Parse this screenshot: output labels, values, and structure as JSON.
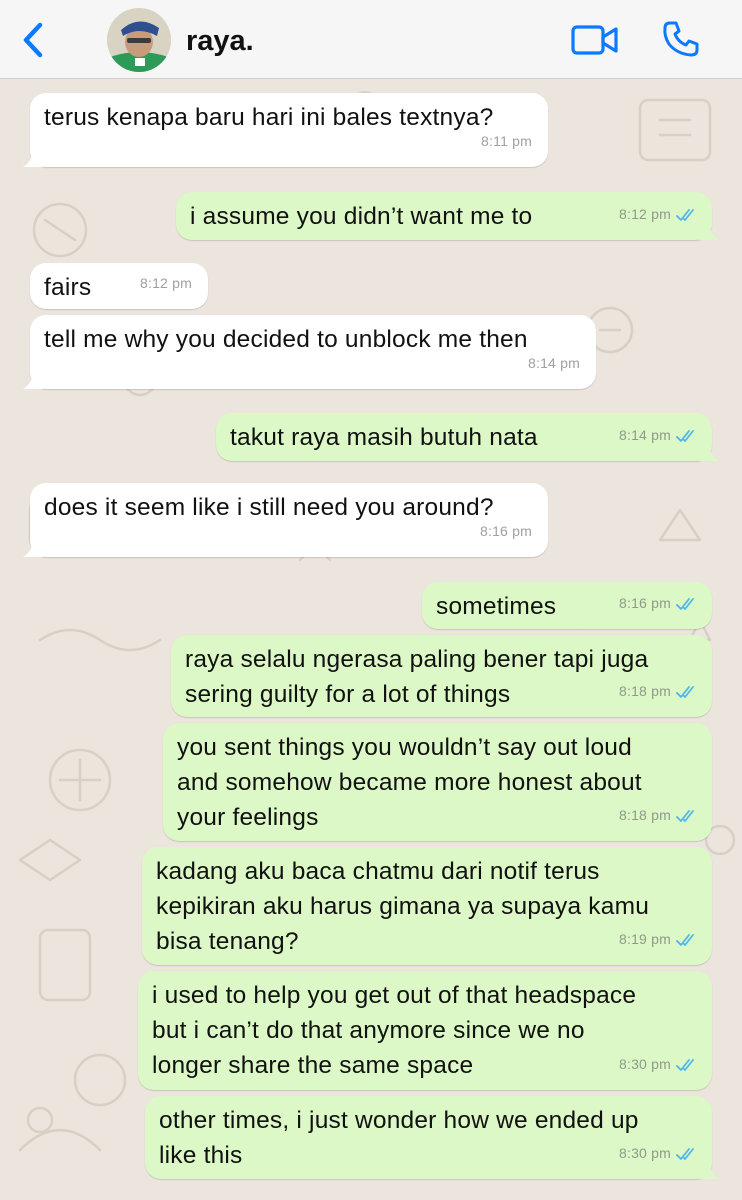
{
  "header": {
    "contact_name": "raya.",
    "back_icon": "chevron-left-icon",
    "video_icon": "video-camera-icon",
    "call_icon": "phone-icon",
    "accent_color": "#0a7aff"
  },
  "messages": [
    {
      "direction": "in",
      "text": "terus kenapa baru hari ini bales textnya?",
      "time": "8:11 pm"
    },
    {
      "direction": "out",
      "text": "i assume you didn’t want me to",
      "time": "8:12 pm",
      "status": "read"
    },
    {
      "direction": "in",
      "text": "fairs",
      "time": "8:12 pm"
    },
    {
      "direction": "in",
      "text": "tell me why you decided to unblock me then",
      "time": "8:14 pm"
    },
    {
      "direction": "out",
      "text": "takut raya masih butuh nata",
      "time": "8:14 pm",
      "status": "read"
    },
    {
      "direction": "in",
      "text": "does it seem like i still need you around?",
      "time": "8:16 pm"
    },
    {
      "direction": "out",
      "text": "sometimes",
      "time": "8:16 pm",
      "status": "read"
    },
    {
      "direction": "out",
      "text": "raya selalu ngerasa paling bener tapi juga\nsering guilty for a lot of things",
      "time": "8:18 pm",
      "status": "read"
    },
    {
      "direction": "out",
      "text": "you sent things you wouldn’t say out loud\nand somehow became more honest about\nyour feelings",
      "time": "8:18 pm",
      "status": "read"
    },
    {
      "direction": "out",
      "text": "kadang aku baca chatmu dari notif terus\nkepikiran aku harus gimana ya supaya kamu\nbisa tenang?",
      "time": "8:19 pm",
      "status": "read"
    },
    {
      "direction": "out",
      "text": "i used to help you get out of that headspace\nbut i can’t do that anymore since we no\nlonger share the same space",
      "time": "8:30 pm",
      "status": "read"
    },
    {
      "direction": "out",
      "text": "other times, i just wonder how we ended up\nlike this",
      "time": "8:30 pm",
      "status": "read"
    }
  ],
  "colors": {
    "incoming_bubble": "#ffffff",
    "outgoing_bubble": "#dcf8c6",
    "chat_background": "#ece5dd",
    "read_ticks": "#4fb6ec"
  }
}
